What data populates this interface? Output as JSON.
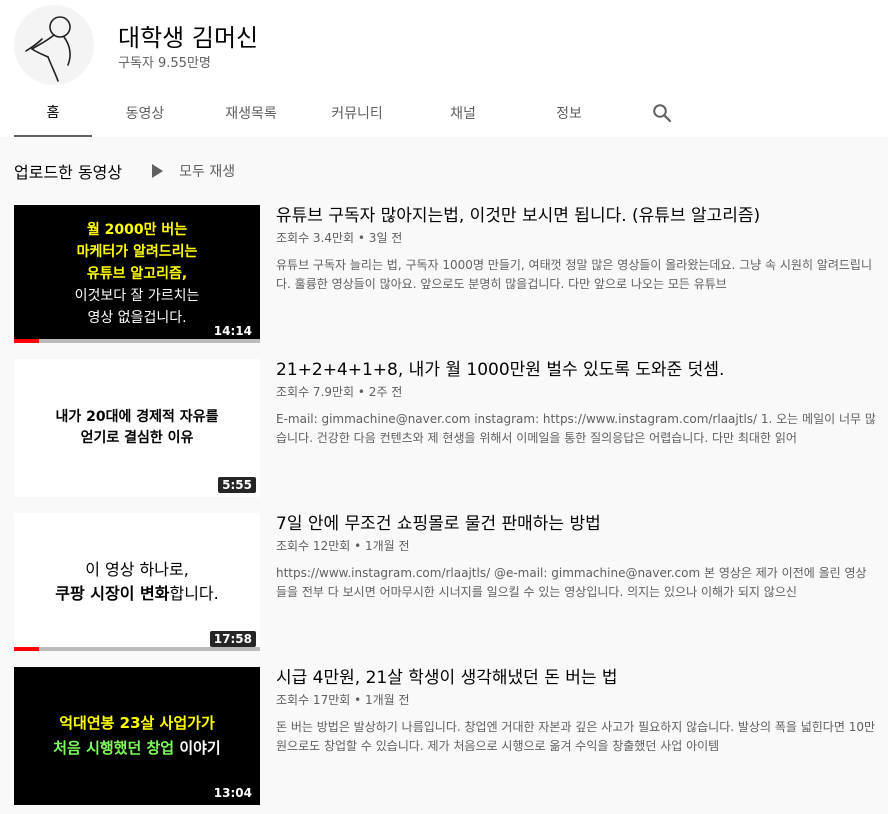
{
  "channel": {
    "name": "대학생 김머신",
    "subscribers": "구독자 9.55만명"
  },
  "tabs": [
    {
      "label": "홈",
      "active": true
    },
    {
      "label": "동영상"
    },
    {
      "label": "재생목록"
    },
    {
      "label": "커뮤니티"
    },
    {
      "label": "채널"
    },
    {
      "label": "정보"
    }
  ],
  "section": {
    "title": "업로드한 동영상",
    "play_all": "모두 재생"
  },
  "videos": [
    {
      "title": "유튜브 구독자 많아지는법, 이것만 보시면 됩니다. (유튜브 알고리즘)",
      "stats": "조회수 3.4만회 • 3일 전",
      "description": "유튜브 구독자 늘리는 법, 구독자 1000명 만들기, 여태껏 정말 많은 영상들이 올라왔는데요. 그냥 속 시원히 알려드립니다. 훌륭한 영상들이 많아요. 앞으로도 분명히 많을겁니다. 다만 앞으로 나오는 모든 유튜브",
      "duration": "14:14",
      "progress": 0.1,
      "thumb_lines": [
        "월 2000만 버는",
        "마케터가 알려드리는",
        "유튜브 알고리즘,",
        "이것보다 잘 가르치는",
        "영상 없을겁니다."
      ]
    },
    {
      "title": "21+2+4+1+8, 내가 월 1000만원 벌수 있도록 도와준 덧셈.",
      "stats": "조회수 7.9만회 • 2주 전",
      "description": "E-mail: gimmachine@naver.com instagram: https://www.instagram.com/rlaajtls/ 1. 오는 메일이 너무 많습니다. 건강한 다음 컨텐츠와 제 현생을 위해서 이메일을 통한 질의응답은 어렵습니다. 다만 최대한 읽어",
      "duration": "5:55",
      "progress": 0,
      "thumb_lines": [
        "내가 20대에 경제적 자유를",
        "얻기로 결심한 이유"
      ]
    },
    {
      "title": "7일 안에 무조건 쇼핑몰로 물건 판매하는 방법",
      "stats": "조회수 12만회 • 1개월 전",
      "description": "https://www.instagram.com/rlaajtls/ @e-mail: gimmachine@naver.com 본 영상은 제가 이전에 올린 영상들을 전부 다 보시면 어마무시한 시너지를 일으킬 수 있는 영상입니다. 의지는 있으나 이해가 되지 않으신",
      "duration": "17:58",
      "progress": 0.1,
      "thumb_lines": [
        "이 영상 하나로,",
        "쿠팡 시장이 변화",
        "합니다."
      ]
    },
    {
      "title": "시급 4만원, 21살 학생이 생각해냈던 돈 버는 법",
      "stats": "조회수 17만회 • 1개월 전",
      "description": "돈 버는 방법은 발상하기 나름입니다. 창업엔 거대한 자본과 깊은 사고가 필요하지 않습니다. 발상의 폭을 넓힌다면 10만원으로도 창업할 수 있습니다. 제가 처음으로 시행으로 옮겨 수익을 창출했던 사업 아이템",
      "duration": "13:04",
      "progress": 0,
      "thumb_lines": [
        "억대연봉 23살 사업가가",
        "처음 시행했던 창업",
        " 이야기"
      ]
    }
  ]
}
